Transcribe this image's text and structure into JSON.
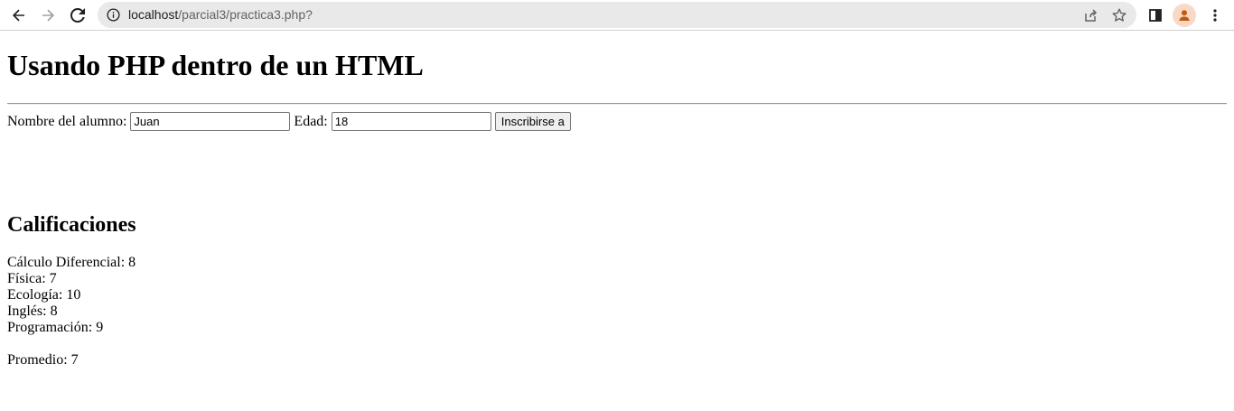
{
  "browser": {
    "url_host": "localhost",
    "url_path": "/parcial3/practica3.php?"
  },
  "page": {
    "title": "Usando PHP dentro de un HTML",
    "form": {
      "name_label": "Nombre del alumno:",
      "name_value": "Juan",
      "age_label": "Edad:",
      "age_value": "18",
      "submit_label": "Inscribirse a"
    },
    "grades_heading": "Calificaciones",
    "grades": [
      {
        "subject": "Cálculo Diferencial",
        "score": "8"
      },
      {
        "subject": "Física",
        "score": "7"
      },
      {
        "subject": "Ecología",
        "score": "10"
      },
      {
        "subject": "Inglés",
        "score": "8"
      },
      {
        "subject": "Programación",
        "score": "9"
      }
    ],
    "average_label": "Promedio",
    "average_value": "7"
  }
}
